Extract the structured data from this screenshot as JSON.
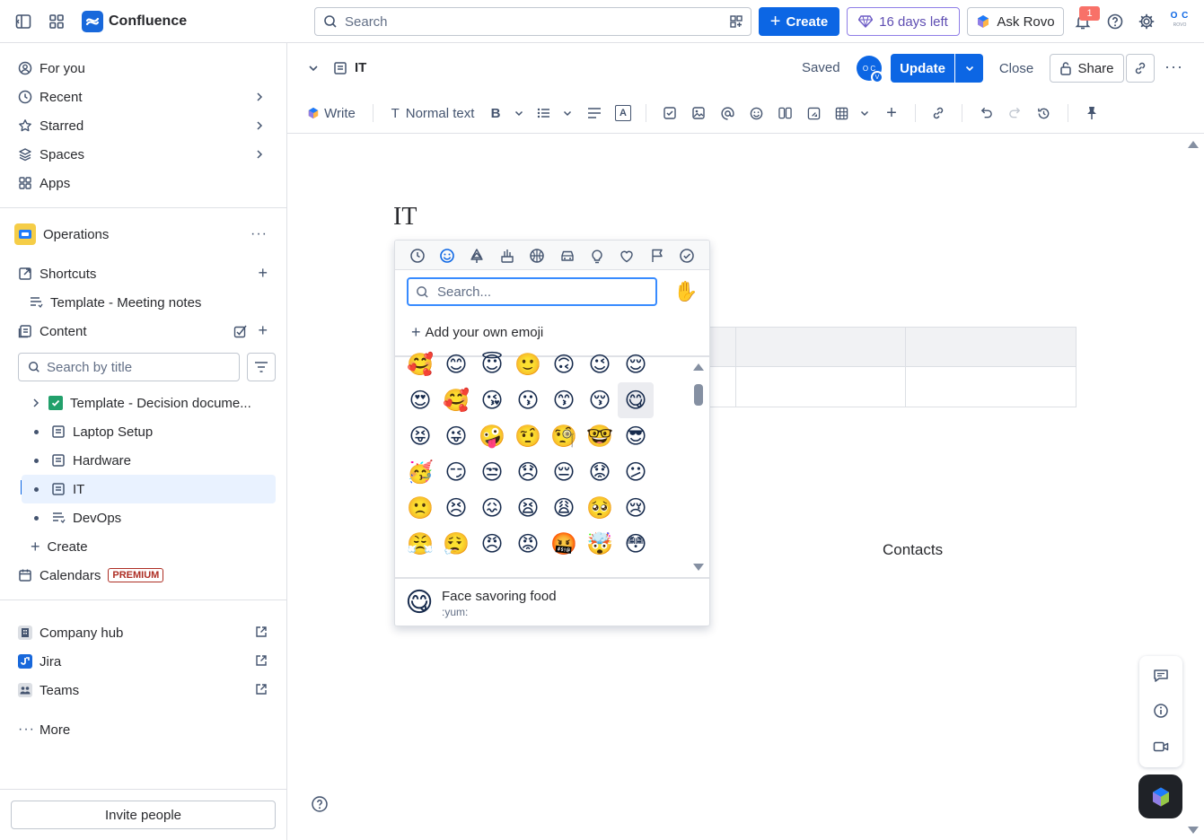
{
  "topbar": {
    "app_name": "Confluence",
    "search_placeholder": "Search",
    "create_label": "Create",
    "trial_label": "16 days left",
    "ask_rovo_label": "Ask Rovo",
    "notification_count": "1",
    "avatar_initials": "O C",
    "avatar_sub": "ROVO"
  },
  "sidebar": {
    "nav": [
      {
        "label": "For you",
        "icon": "person-circle-icon"
      },
      {
        "label": "Recent",
        "icon": "clock-icon"
      },
      {
        "label": "Starred",
        "icon": "star-icon"
      },
      {
        "label": "Spaces",
        "icon": "spaces-icon"
      },
      {
        "label": "Apps",
        "icon": "apps-icon"
      }
    ],
    "space_name": "Operations",
    "shortcuts_label": "Shortcuts",
    "shortcut_item": "Template - Meeting notes",
    "content_label": "Content",
    "search_placeholder": "Search by title",
    "tree": [
      {
        "label": "Template - Decision docume...",
        "icon": "check-box-icon"
      },
      {
        "label": "Laptop Setup",
        "icon": "page-icon"
      },
      {
        "label": "Hardware",
        "icon": "page-icon"
      },
      {
        "label": "IT",
        "icon": "page-icon"
      },
      {
        "label": "DevOps",
        "icon": "live-doc-icon"
      }
    ],
    "create_label": "Create",
    "calendars_label": "Calendars",
    "premium_badge": "PREMIUM",
    "external": [
      {
        "label": "Company hub"
      },
      {
        "label": "Jira"
      },
      {
        "label": "Teams"
      }
    ],
    "more_label": "More",
    "invite_label": "Invite people"
  },
  "editor": {
    "breadcrumb_title": "IT",
    "saved_label": "Saved",
    "avatar_initials": "O C",
    "avatar_badge": "V",
    "update_label": "Update",
    "close_label": "Close",
    "share_label": "Share",
    "toolbar": {
      "write_label": "Write",
      "text_style_label": "Normal text"
    },
    "page_title": "IT",
    "table_text": "Contacts"
  },
  "emoji_picker": {
    "search_placeholder": "Search...",
    "add_own_label": "Add your own emoji",
    "skin_tone_emoji": "✋",
    "categories": [
      "clock-icon",
      "smiley-icon",
      "tree-icon",
      "food-icon",
      "ball-icon",
      "car-icon",
      "bulb-icon",
      "heart-icon",
      "flag-icon",
      "check-circle-icon"
    ],
    "grid": [
      [
        "🥰",
        "😊",
        "😇",
        "🙂",
        "🙃",
        "😉",
        "😌"
      ],
      [
        "😍",
        "🥰",
        "😘",
        "😗",
        "😙",
        "😚",
        "😋"
      ],
      [
        "😝",
        "😜",
        "🤪",
        "🤨",
        "🧐",
        "🤓",
        "😎"
      ],
      [
        "🥳",
        "😏",
        "😒",
        "😞",
        "😔",
        "😟",
        "😕"
      ],
      [
        "🙁",
        "😣",
        "😖",
        "😫",
        "😩",
        "🥺",
        "😢"
      ],
      [
        "😤",
        "😮‍💨",
        "😠",
        "😡",
        "🤬",
        "🤯",
        "😳"
      ]
    ],
    "selected_emoji": "😋",
    "selected_name": "Face savoring food",
    "selected_shortcode": ":yum:"
  },
  "colors": {
    "primary": "#0c66e4",
    "trial": "#6e5dc6",
    "selected_bg": "#e9f2ff"
  }
}
